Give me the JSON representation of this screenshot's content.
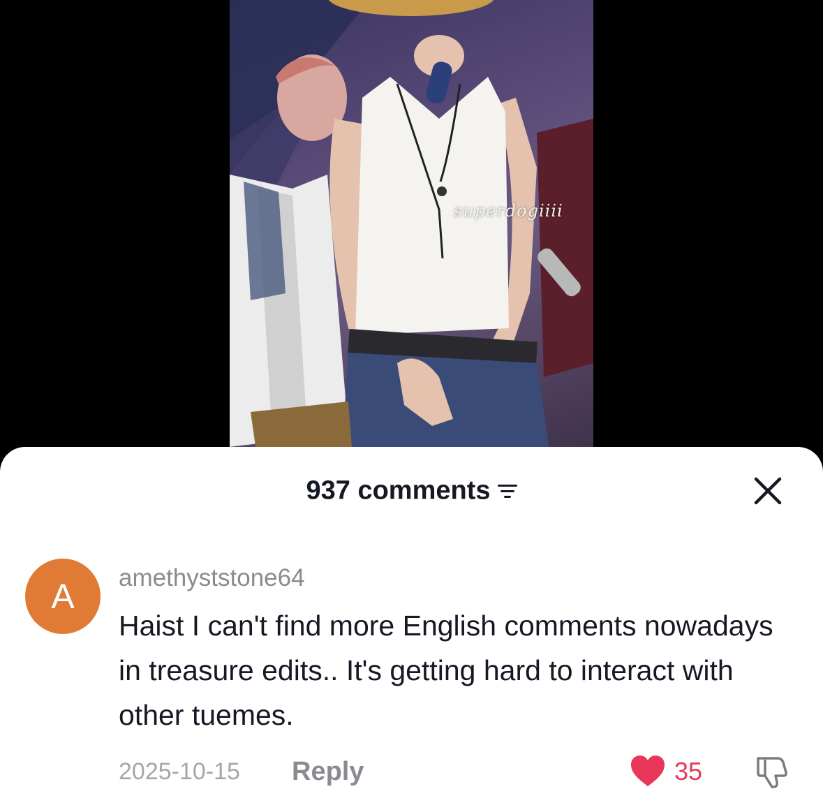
{
  "video": {
    "watermark": "superdogiiii"
  },
  "sheet": {
    "comments_count_label": "937 comments",
    "sort_icon": "sort-lines-icon",
    "close_icon": "close-icon"
  },
  "comment": {
    "avatar_letter": "A",
    "avatar_color": "#e07a35",
    "username": "amethyststone64",
    "text": "Haist I can't find more English comments nowadays in treasure edits.. It's getting hard to interact with other tuemes.",
    "date": "2025-10-15",
    "reply_label": "Reply",
    "like_count": "35",
    "like_color": "#e8385a",
    "like_icon": "heart-filled-icon",
    "dislike_icon": "thumbs-down-icon"
  }
}
